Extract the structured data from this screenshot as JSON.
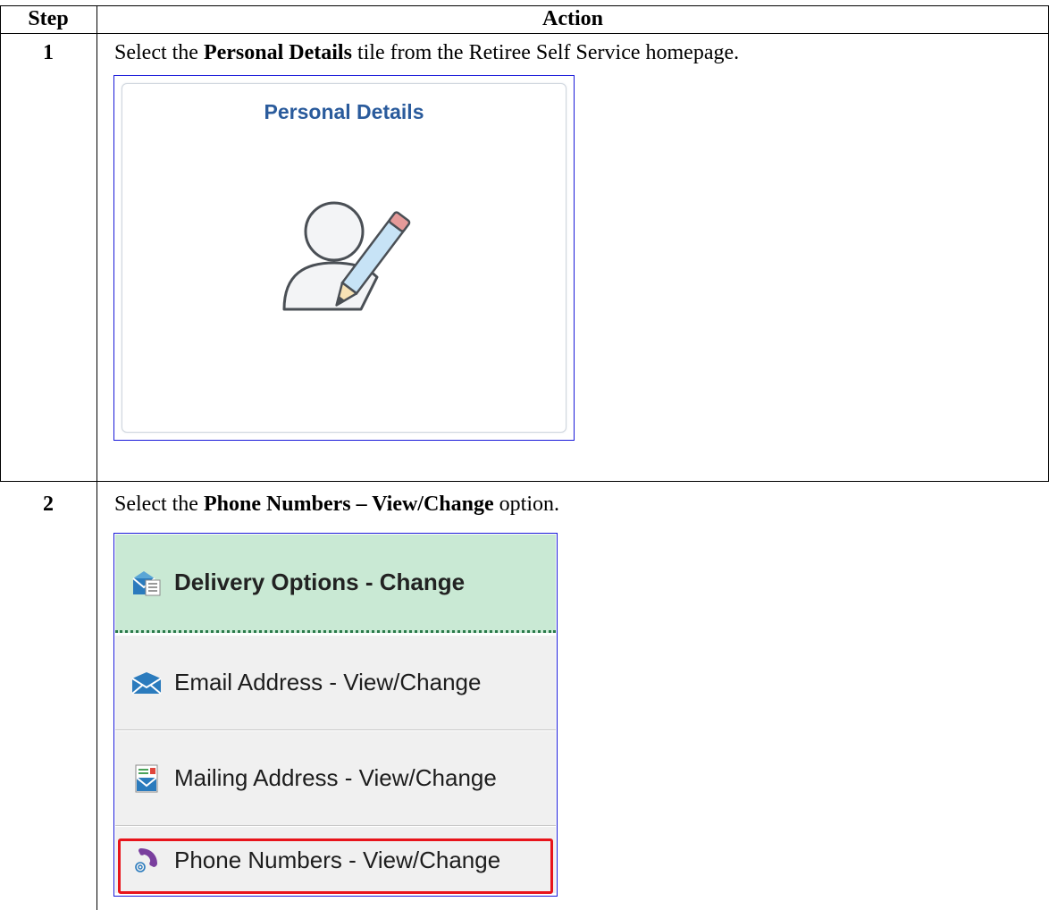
{
  "table": {
    "header": {
      "step": "Step",
      "action": "Action"
    },
    "rows": [
      {
        "step": "1",
        "text_before": "Select the ",
        "text_bold": "Personal Details",
        "text_after": " tile from the Retiree Self Service homepage.",
        "tile": {
          "title": "Personal Details",
          "icon": "user-edit-icon"
        }
      },
      {
        "step": "2",
        "text_before": "Select the ",
        "text_bold": "Phone Numbers – View/Change",
        "text_after": " option.",
        "menu": {
          "items": [
            {
              "label": "Delivery Options - Change",
              "icon": "delivery-options-icon"
            },
            {
              "label": "Email Address - View/Change",
              "icon": "email-envelope-icon"
            },
            {
              "label": "Mailing Address - View/Change",
              "icon": "mailing-address-icon"
            },
            {
              "label": "Phone Numbers - View/Change",
              "icon": "phone-at-icon"
            }
          ],
          "highlighted_item_color": "#e8141b"
        }
      }
    ]
  },
  "colors": {
    "tile_title": "#2a5b9c",
    "menu_selected_bg": "#c9e9d4",
    "screenshot_border": "#1a1ad9"
  }
}
